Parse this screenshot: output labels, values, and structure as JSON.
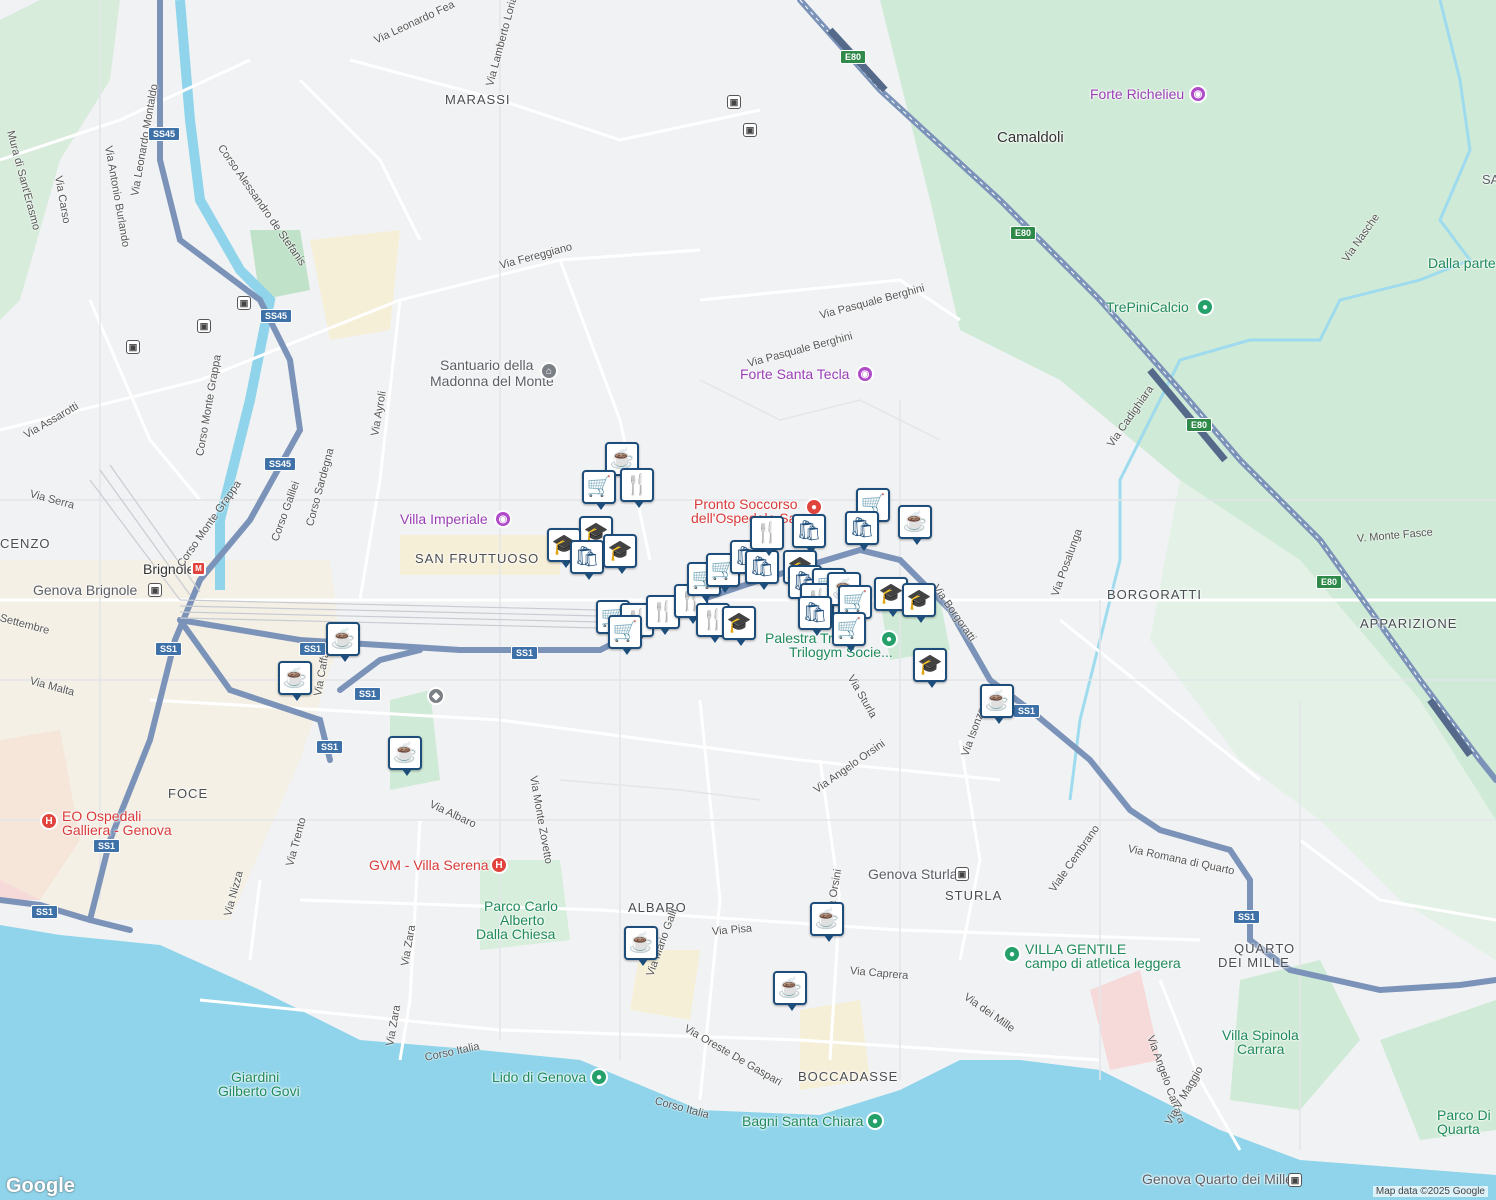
{
  "map": {
    "attribution": "Map data ©2025 Google",
    "logo": "Google",
    "districts": [
      "MARASSI",
      "SAN FRUTTUOSO",
      "FOCE",
      "ALBARO",
      "BOCCADASSE",
      "STURLA",
      "BORGORATTI",
      "APPARIZIONE",
      "QUARTO",
      "DEI MILLE",
      "CENZO"
    ],
    "places": [
      "Camaldoli",
      "Brignole"
    ],
    "pois": {
      "forte_richelieu": "Forte Richelieu",
      "tre_pini": "TrePiniCalcio",
      "santuario_1": "Santuario della",
      "santuario_2": "Madonna del Monte",
      "forte_santa_tecla": "Forte Santa Tecla",
      "pronto_1": "Pronto Soccorso",
      "pronto_2": "dell'Ospedale San...",
      "villa_imperiale": "Villa Imperiale",
      "genova_brignole": "Genova Brignole",
      "palestra_1": "Palestra Tri...",
      "palestra_2": "Trilogym Socie...",
      "eo_1": "EO Ospedali",
      "eo_2": "Galliera - Genova",
      "gvm": "GVM - Villa Serena",
      "parco_1": "Parco Carlo",
      "parco_2": "Alberto",
      "parco_3": "Dalla Chiesa",
      "genova_sturla": "Genova Sturla",
      "villa_gentile_1": "VILLA GENTILE",
      "villa_gentile_2": "campo di atletica leggera",
      "lido": "Lido di Genova",
      "bagni": "Bagni Santa Chiara",
      "giardini_1": "Giardini",
      "giardini_2": "Gilberto Govi",
      "villa_spinola_1": "Villa Spinola",
      "villa_spinola_2": "Carrara",
      "parco_di_1": "Parco Di",
      "parco_di_2": "Quarta",
      "quarto_station": "Genova Quarto dei Mille",
      "dalla_parte": "Dalla parte",
      "sa": "SA"
    },
    "roads": [
      "Via Leonardo Fea",
      "Via Lamberto Loria",
      "Corso Alessandro de Stefanis",
      "Via Leonardo Montaldo",
      "Via Antonio Burlando",
      "Via Carso",
      "Mura di Sant'Erasmo",
      "Via Fereggiano",
      "Via Pasquale Berghini",
      "Via Pasquale Berghini",
      "Via Assarotti",
      "Corso Monte Grappa",
      "Corso Monte Grappa",
      "Via Ayroli",
      "Corso Sardegna",
      "Corso Galilei",
      "Via Serra",
      "Settembre",
      "Via Malta",
      "Via Monte Zovetto",
      "Via Albaro",
      "Via Trento",
      "Via Nizza",
      "Via Zara",
      "Via Zara",
      "Via Mario Galli",
      "Via Pisa",
      "Via Oreste De Gaspari",
      "Corso Italia",
      "Corso Italia",
      "Via Caprera",
      "Via dei Mille",
      "Via Sturla",
      "Via Angelo Orsini",
      "Via Orsini",
      "Via Isonzo",
      "Via Borgoratti",
      "Via Posalunga",
      "Via Cadighiara",
      "Via Nasche",
      "V. Monte Fasce",
      "Viale Cembrano",
      "Via Romana di Quarto",
      "Via Angelo Carrara",
      "Via V Maggio",
      "Via Caffa"
    ],
    "shields": [
      "E80",
      "E80",
      "E80",
      "E80",
      "SS45",
      "SS45",
      "SS45",
      "SS1",
      "SS1",
      "SS1",
      "SS1",
      "SS1",
      "SS1",
      "SS1",
      "SS1",
      "SS1"
    ],
    "marker_icons": {
      "cafe": "coffee-cup-icon",
      "shop": "shopping-cart-icon",
      "bag": "shopping-bag-icon",
      "food": "restaurant-icon",
      "school": "school-icon"
    },
    "colors": {
      "water": "#8fd4ea",
      "park": "#cfead6",
      "road": "#ffffff",
      "highway": "#7b93b8",
      "marker": "#1d4d7a"
    }
  }
}
